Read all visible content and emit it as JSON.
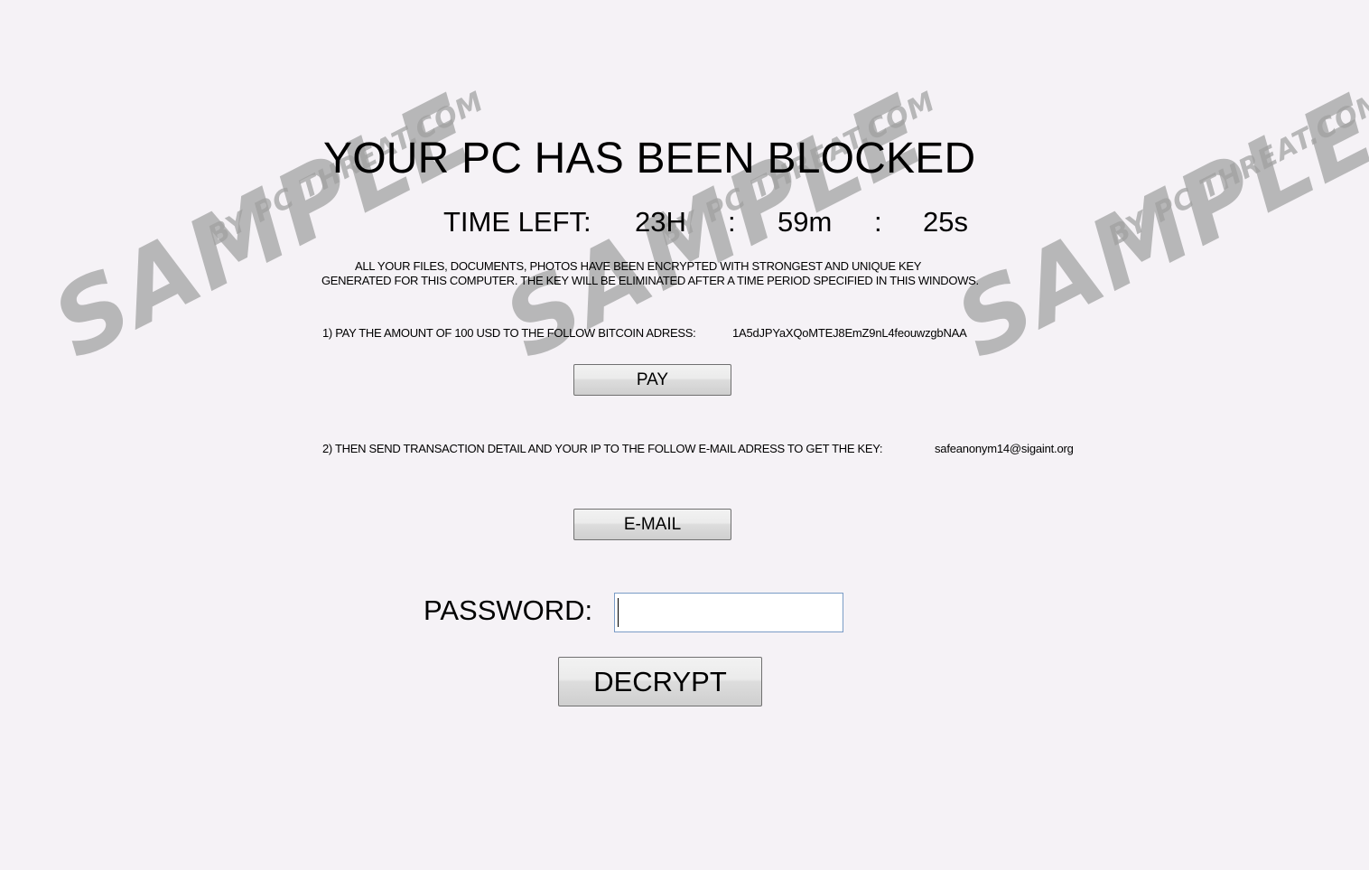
{
  "title": "YOUR PC HAS BEEN BLOCKED",
  "timer": {
    "label": "TIME LEFT:",
    "hours": "23H",
    "separator": ":",
    "minutes": "59m",
    "seconds": "25s"
  },
  "description": {
    "line1": "ALL YOUR FILES, DOCUMENTS, PHOTOS HAVE BEEN ENCRYPTED WITH STRONGEST AND UNIQUE KEY",
    "line2": "GENERATED FOR THIS COMPUTER. THE KEY WILL BE ELIMINATED AFTER A TIME PERIOD SPECIFIED IN THIS WINDOWS."
  },
  "step1": {
    "text": "1) PAY THE AMOUNT OF 100 USD TO THE FOLLOW BITCOIN ADRESS:",
    "bitcoin_address": "1A5dJPYaXQoMTEJ8EmZ9nL4feouwzgbNAA",
    "button_label": "PAY"
  },
  "step2": {
    "text": "2) THEN SEND TRANSACTION DETAIL AND YOUR IP TO THE FOLLOW E-MAIL ADRESS TO GET THE KEY:",
    "email": "safeanonym14@sigaint.org",
    "button_label": "E-MAIL"
  },
  "password": {
    "label": "PASSWORD:",
    "value": ""
  },
  "decrypt_button_label": "DECRYPT",
  "watermark": {
    "main": "SAMPLE",
    "sub": "BY PC THREAT.COM",
    "color": "#a0a0a0"
  }
}
